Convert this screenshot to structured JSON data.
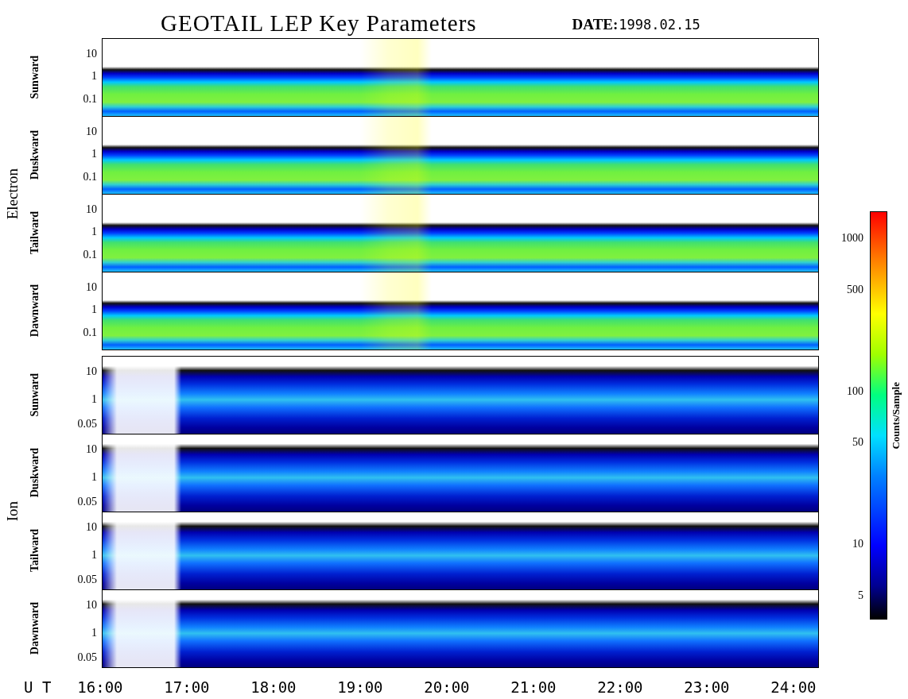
{
  "title": "GEOTAIL LEP Key Parameters",
  "date": {
    "label": "DATE:",
    "value": "1998.02.15"
  },
  "groups": [
    {
      "label": "Electron",
      "kind": "electron",
      "panels": [
        {
          "label": "Sunward",
          "yticks": [
            "10",
            "1",
            "0.1"
          ]
        },
        {
          "label": "Duskward",
          "yticks": [
            "10",
            "1",
            "0.1"
          ]
        },
        {
          "label": "Tailward",
          "yticks": [
            "10",
            "1",
            "0.1"
          ]
        },
        {
          "label": "Dawnward",
          "yticks": [
            "10",
            "1",
            "0.1"
          ]
        }
      ]
    },
    {
      "label": "Ion",
      "kind": "ion",
      "panels": [
        {
          "label": "Sunward",
          "yticks": [
            "10",
            "1",
            "0.05"
          ]
        },
        {
          "label": "Duskward",
          "yticks": [
            "10",
            "1",
            "0.05"
          ]
        },
        {
          "label": "Tailward",
          "yticks": [
            "10",
            "1",
            "0.05"
          ]
        },
        {
          "label": "Dawnward",
          "yticks": [
            "10",
            "1",
            "0.05"
          ]
        }
      ]
    }
  ],
  "x_axis": {
    "label": "U T",
    "ticks": [
      "16:00",
      "17:00",
      "18:00",
      "19:00",
      "20:00",
      "21:00",
      "22:00",
      "23:00",
      "24:00"
    ]
  },
  "colorbar": {
    "label": "Counts/Sample",
    "ticks": [
      "1000",
      "500",
      "100",
      "50",
      "10",
      "5"
    ]
  }
}
